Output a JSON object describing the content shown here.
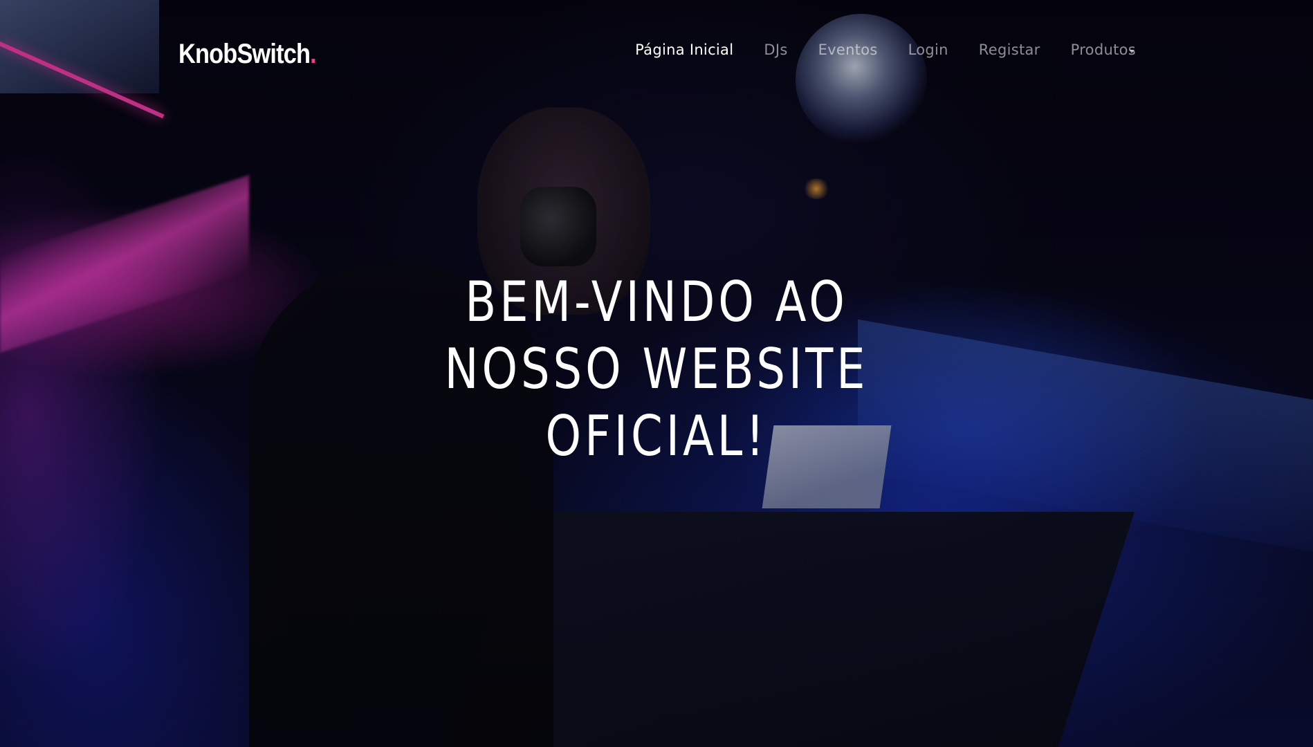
{
  "brand": {
    "name": "KnobSwitch",
    "dot": ".",
    "dot_color": "#f23a87"
  },
  "nav": {
    "items": [
      {
        "label": "Página Inicial",
        "active": true
      },
      {
        "label": "DJs",
        "active": false
      },
      {
        "label": "Eventos",
        "active": false
      },
      {
        "label": "Login",
        "active": false
      },
      {
        "label": "Registar",
        "active": false
      },
      {
        "label": "Produtos",
        "active": false,
        "has_dropdown": true
      }
    ],
    "dropdown_icon": "chevron-down-icon"
  },
  "hero": {
    "title_line_1": "BEM-VINDO AO",
    "title_line_2": "NOSSO WEBSITE",
    "title_line_3": "OFICIAL!",
    "background": "dj-mixing-club-photo",
    "accent_colors": [
      "#ff3fb0",
      "#2a4cff"
    ]
  }
}
